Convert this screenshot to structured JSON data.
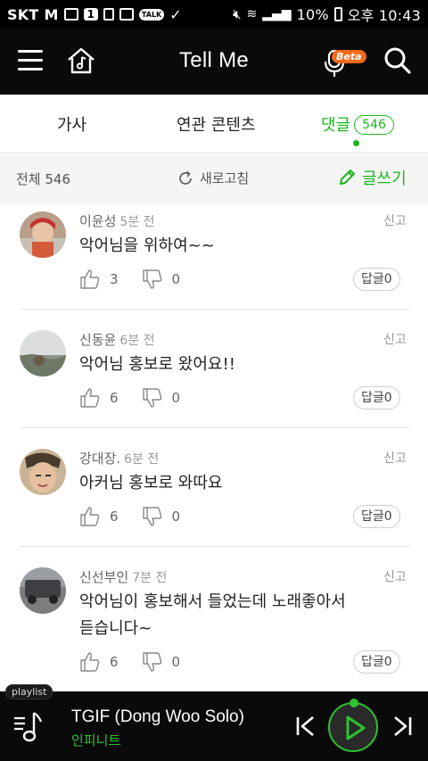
{
  "status_bar": {
    "carrier": "SKT",
    "carrier_m": "M",
    "notif_count": "1",
    "talk": "TALK",
    "battery": "10%",
    "time": "오후 10:43"
  },
  "header": {
    "title": "Tell Me",
    "beta": "Beta"
  },
  "tabs": [
    {
      "label": "가사"
    },
    {
      "label": "연관 콘텐츠"
    },
    {
      "label": "댓글",
      "count": "546"
    }
  ],
  "toolbar": {
    "total_label": "전체 546",
    "refresh_label": "새로고침",
    "write_label": "글쓰기"
  },
  "comments": [
    {
      "author": "이윤성",
      "time": "5분 전",
      "report": "신고",
      "body": "악어님을 위하여~~",
      "likes": "3",
      "dislikes": "0",
      "reply": "답글0"
    },
    {
      "author": "신동윤",
      "time": "6분 전",
      "report": "신고",
      "body": "악어님 홍보로 왔어요!!",
      "likes": "6",
      "dislikes": "0",
      "reply": "답글0"
    },
    {
      "author": "강대장.",
      "time": "6분 전",
      "report": "신고",
      "body": "아커님 홍보로 와따요",
      "likes": "6",
      "dislikes": "0",
      "reply": "답글0"
    },
    {
      "author": "신선부인",
      "time": "7분 전",
      "report": "신고",
      "body_line1": "악어님이 홍보해서 들었는데 노래좋아서",
      "body_line2": "듣습니다~",
      "likes": "6",
      "dislikes": "0",
      "reply": "답글0"
    }
  ],
  "player": {
    "playlist_tag": "playlist",
    "track_title": "TGIF (Dong Woo Solo)",
    "artist": "인피니트"
  },
  "colors": {
    "accent": "#19b81d",
    "header_bg": "#0a0a0a",
    "toolbar_bg": "#f5f5f5",
    "beta": "#f26a1b"
  }
}
